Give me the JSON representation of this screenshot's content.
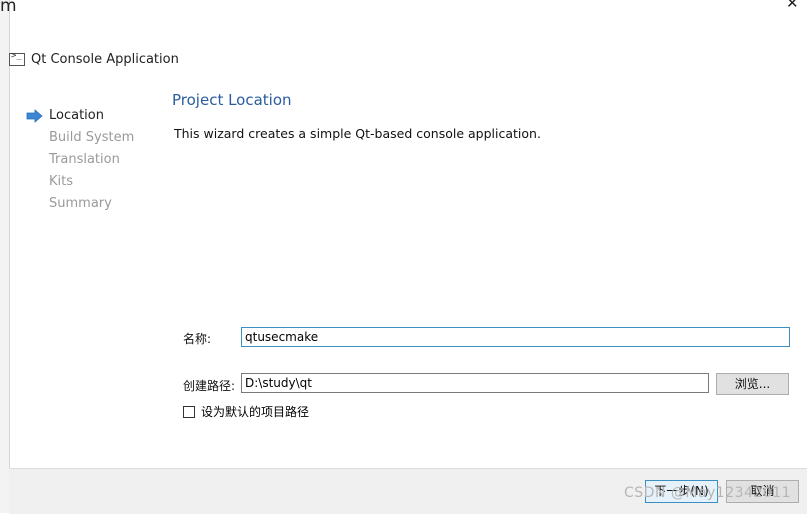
{
  "window": {
    "corner_glyph": "m",
    "close_glyph": "✕",
    "title": "Qt Console Application",
    "title_icon": "console-app-icon"
  },
  "steps": [
    {
      "label": "Location",
      "active": true
    },
    {
      "label": "Build System",
      "active": false
    },
    {
      "label": "Translation",
      "active": false
    },
    {
      "label": "Kits",
      "active": false
    },
    {
      "label": "Summary",
      "active": false
    }
  ],
  "page": {
    "title": "Project Location",
    "description": "This wizard creates a simple Qt-based console application."
  },
  "form": {
    "name_label": "名称:",
    "name_value": "qtusecmake",
    "path_label": "创建路径:",
    "path_value": "D:\\study\\qt",
    "browse_label": "浏览...",
    "default_checkbox_label": "设为默认的项目路径",
    "default_checked": false
  },
  "footer": {
    "next_label": "下一步(N)",
    "cancel_label": "取消"
  },
  "watermark": "CSDN @May12342011",
  "colors": {
    "accent_title": "#2a5d9e",
    "active_arrow": "#3c87d4",
    "focus_border": "#3c8fc0"
  }
}
